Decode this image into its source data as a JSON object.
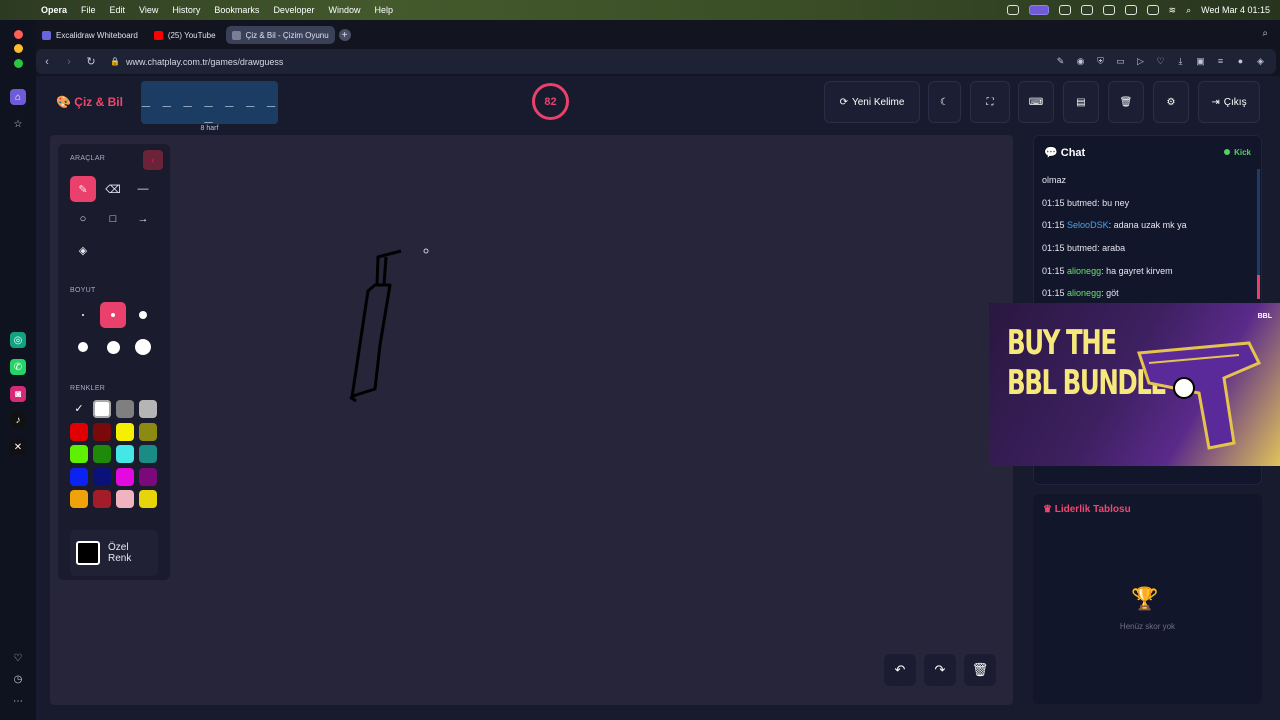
{
  "menubar": {
    "app_name": "Opera",
    "items": [
      "File",
      "Edit",
      "View",
      "History",
      "Bookmarks",
      "Developer",
      "Window",
      "Help"
    ],
    "clock": "Wed Mar 4  01:15"
  },
  "browser": {
    "tabs": [
      {
        "label": "Excalidraw Whiteboard",
        "color": "#6965db",
        "active": false
      },
      {
        "label": "(25) YouTube",
        "color": "#ff0000",
        "active": false
      },
      {
        "label": "Çiz & Bil - Çizim Oyunu",
        "color": "#7a7f98",
        "active": true
      }
    ],
    "url": "www.chatplay.com.tr/games/drawguess"
  },
  "header": {
    "logo": "Çiz & Bil",
    "word_mask": "_ _ _ _ _ _ _ _",
    "word_hint": "8 harf",
    "timer": "82",
    "new_word": "Yeni Kelime",
    "exit": "Çıkış"
  },
  "tools": {
    "section_tools": "ARAÇLAR",
    "section_size": "BOYUT",
    "section_colors": "RENKLER",
    "custom_color_line1": "Özel",
    "custom_color_line2": "Renk",
    "colors": [
      "#000000",
      "#ffffff",
      "#7f7f7f",
      "#b5b5b5",
      "#e00000",
      "#7a0a0a",
      "#f5f000",
      "#8c8a12",
      "#5ef000",
      "#1f8a0a",
      "#44e6e6",
      "#1a8c85",
      "#0b22f0",
      "#0a127a",
      "#e30ae0",
      "#7a0a7a",
      "#f0a20a",
      "#a31c2a",
      "#f0b3c0",
      "#e8d40a"
    ],
    "selected_color": "#ffffff"
  },
  "chat": {
    "title": "Chat",
    "source": "Kick",
    "messages": [
      {
        "time": "",
        "user": "",
        "user_color": "#e6e6ef",
        "text": "olmaz"
      },
      {
        "time": "01:15",
        "user": "butmed",
        "user_color": "#e6e6ef",
        "text": "bu ney"
      },
      {
        "time": "01:15",
        "user": "SelooDSK",
        "user_color": "#4aa3f0",
        "text": "adana uzak mk ya"
      },
      {
        "time": "01:15",
        "user": "butmed",
        "user_color": "#e6e6ef",
        "text": "araba"
      },
      {
        "time": "01:15",
        "user": "alionegg",
        "user_color": "#6ae06a",
        "text": "ha gayret kirvem"
      },
      {
        "time": "01:15",
        "user": "alionegg",
        "user_color": "#6ae06a",
        "text": "göt"
      }
    ]
  },
  "leaderboard": {
    "title": "Liderlik Tablosu",
    "empty": "Henüz skor yok"
  },
  "ad": {
    "line1": "BUY THE",
    "line2": "BBL BUNDLE",
    "brand": "BBL"
  }
}
